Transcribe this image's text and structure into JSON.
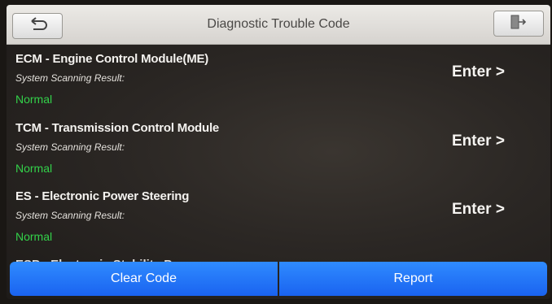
{
  "header": {
    "title": "Diagnostic Trouble Code",
    "back_icon": "back-arrow-icon",
    "exit_icon": "exit-door-icon"
  },
  "modules": [
    {
      "name": "ECM - Engine Control Module(ME)",
      "scan_label": "System Scanning Result:",
      "status": "Normal",
      "enter_label": "Enter >"
    },
    {
      "name": "TCM - Transmission Control Module",
      "scan_label": "System Scanning Result:",
      "status": "Normal",
      "enter_label": "Enter >"
    },
    {
      "name": "ES - Electronic Power Steering",
      "scan_label": "System Scanning Result:",
      "status": "Normal",
      "enter_label": "Enter >"
    }
  ],
  "partial_module": {
    "name": "ESP - Electronic Stability Program"
  },
  "footer": {
    "clear_label": "Clear Code",
    "report_label": "Report"
  },
  "colors": {
    "status_normal": "#33d24a",
    "button_blue": "#1a63f0"
  }
}
